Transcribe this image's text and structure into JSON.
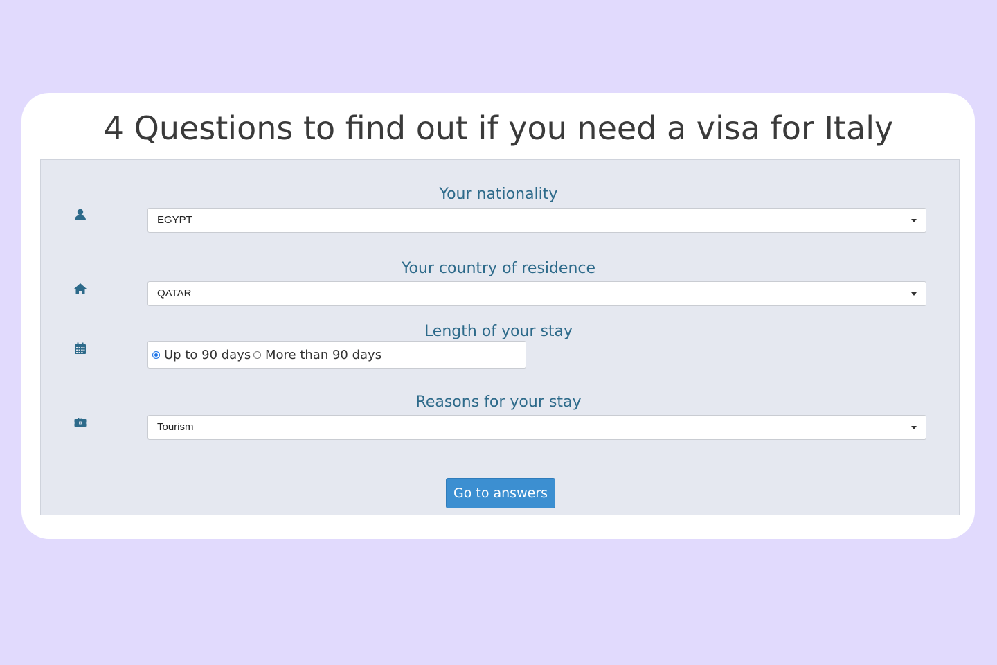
{
  "page": {
    "title": "4 Questions to find out if you need a visa for Italy"
  },
  "colors": {
    "background": "#e1dafd",
    "card": "#ffffff",
    "panel": "#e5e8f0",
    "label": "#2d6a8a",
    "button": "#3c8fd1",
    "radio_checked": "#1a73e8"
  },
  "questions": {
    "nationality": {
      "label": "Your nationality",
      "icon": "user-icon",
      "selected": "EGYPT"
    },
    "residence": {
      "label": "Your country of residence",
      "icon": "home-icon",
      "selected": "QATAR"
    },
    "stay_length": {
      "label": "Length of your stay",
      "icon": "calendar-icon",
      "options": [
        {
          "label": "Up to 90 days",
          "checked": true
        },
        {
          "label": "More than 90 days",
          "checked": false
        }
      ]
    },
    "reason": {
      "label": "Reasons for your stay",
      "icon": "briefcase-icon",
      "selected": "Tourism"
    }
  },
  "actions": {
    "submit_label": "Go to answers"
  }
}
